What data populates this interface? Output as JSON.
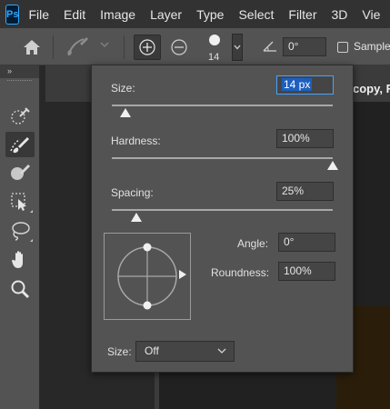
{
  "menubar": {
    "logo": "Ps",
    "items": [
      "File",
      "Edit",
      "Image",
      "Layer",
      "Type",
      "Select",
      "Filter",
      "3D",
      "Vie"
    ]
  },
  "options_bar": {
    "brush_size_value": "14",
    "angle_value": "0°",
    "sample_label": "Sample",
    "icons": [
      "home-icon",
      "brush-preset-icon",
      "chevron-down-icon",
      "add-to-selection-icon",
      "subtract-from-selection-icon",
      "angle-icon"
    ]
  },
  "toolbar": {
    "header": "»",
    "tools": [
      "quick-selection-icon",
      "brush-selection-icon",
      "lasso-brush-icon",
      "object-selection-icon",
      "lasso-icon",
      "hand-icon",
      "zoom-icon"
    ]
  },
  "document": {
    "tab_title": "copy, Ra"
  },
  "brush_popup": {
    "size_label": "Size:",
    "size_value": "14 px",
    "size_slider": 0.06,
    "hardness_label": "Hardness:",
    "hardness_value": "100%",
    "hardness_slider": 1.0,
    "spacing_label": "Spacing:",
    "spacing_value": "25%",
    "spacing_slider": 0.11,
    "angle_label": "Angle:",
    "angle_value": "0°",
    "roundness_label": "Roundness:",
    "roundness_value": "100%",
    "pen_size_label": "Size:",
    "pen_size_value": "Off"
  },
  "colors": {
    "panel": "#535353",
    "background": "#282828",
    "focus": "#4aa3ff",
    "selection": "#1d5fbf"
  }
}
